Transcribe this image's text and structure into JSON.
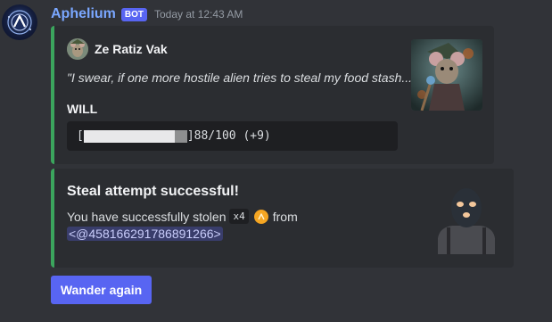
{
  "message": {
    "author": "Aphelium",
    "bot_tag": "BOT",
    "timestamp": "Today at 12:43 AM"
  },
  "embed1": {
    "accent_color": "#3ba55d",
    "author_name": "Ze Ratiz Vak",
    "quote": "\"I swear, if one more hostile alien tries to steal my food stash...\"",
    "field_name": "WILL",
    "bar_text": "]88/100 (+9)",
    "bar_open": "[",
    "will_value": 88,
    "will_max": 100
  },
  "embed2": {
    "accent_color": "#3ba55d",
    "title": "Steal attempt successful!",
    "desc_prefix": "You have successfully stolen",
    "amount": "x4",
    "desc_suffix": "from",
    "mention": "<@458166291786891266>"
  },
  "buttons": {
    "wander_label": "Wander again"
  }
}
